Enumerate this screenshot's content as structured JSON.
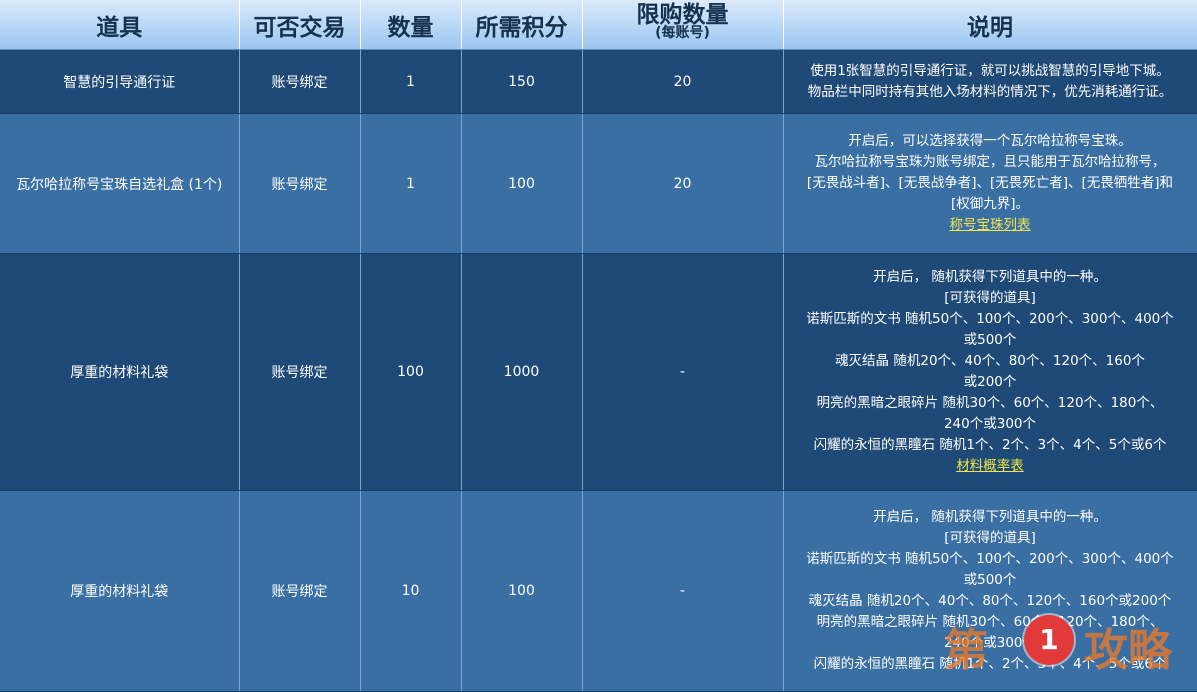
{
  "headers": {
    "item": "道具",
    "tradable": "可否交易",
    "quantity": "数量",
    "points": "所需积分",
    "limit": "限购数量",
    "limit_sub": "(每账号)",
    "description": "说明"
  },
  "rows": [
    {
      "item": "智慧的引导通行证",
      "tradable": "账号绑定",
      "quantity": "1",
      "points": "150",
      "limit": "20",
      "desc": [
        "使用1张智慧的引导通行证，就可以挑战智慧的引导地下城。",
        "物品栏中同时持有其他入场材料的情况下，优先消耗通行证。"
      ],
      "link": ""
    },
    {
      "item": "瓦尔哈拉称号宝珠自选礼盒 (1个)",
      "tradable": "账号绑定",
      "quantity": "1",
      "points": "100",
      "limit": "20",
      "desc": [
        "开启后，可以选择获得一个瓦尔哈拉称号宝珠。",
        "瓦尔哈拉称号宝珠为账号绑定，且只能用于瓦尔哈拉称号，",
        "[无畏战斗者]、[无畏战争者]、[无畏死亡者]、[无畏牺牲者]和",
        "[权御九界]。"
      ],
      "link": "称号宝珠列表"
    },
    {
      "item": "厚重的材料礼袋",
      "tradable": "账号绑定",
      "quantity": "100",
      "points": "1000",
      "limit": "-",
      "desc": [
        "开启后， 随机获得下列道具中的一种。",
        "[可获得的道具]",
        "诺斯匹斯的文书 随机50个、100个、200个、300个、400个",
        "或500个",
        "魂灭结晶 随机20个、40个、80个、120个、160个",
        "或200个",
        "明亮的黑暗之眼碎片 随机30个、60个、120个、180个、",
        "240个或300个",
        "闪耀的永恒的黑瞳石 随机1个、2个、3个、4个、5个或6个"
      ],
      "link": "材料概率表"
    },
    {
      "item": "厚重的材料礼袋",
      "tradable": "账号绑定",
      "quantity": "10",
      "points": "100",
      "limit": "-",
      "desc": [
        "开启后， 随机获得下列道具中的一种。",
        "[可获得的道具]",
        "诺斯匹斯的文书 随机50个、100个、200个、300个、400个",
        "或500个",
        "魂灭结晶 随机20个、40个、80个、120个、160个或200个",
        "明亮的黑暗之眼碎片 随机30个、60个、120个、180个、",
        "240个或300个",
        "闪耀的永恒的黑瞳石 随机1个、2个、3个、4个、5个或6个"
      ],
      "link": ""
    }
  ],
  "watermark": {
    "left": "第",
    "number": "1",
    "right": "攻略"
  },
  "colors": {
    "header_bg": "#b7d6f6",
    "row_dark": "#1f4a78",
    "row_light": "#3a6fa3",
    "link": "#f2e34a"
  }
}
